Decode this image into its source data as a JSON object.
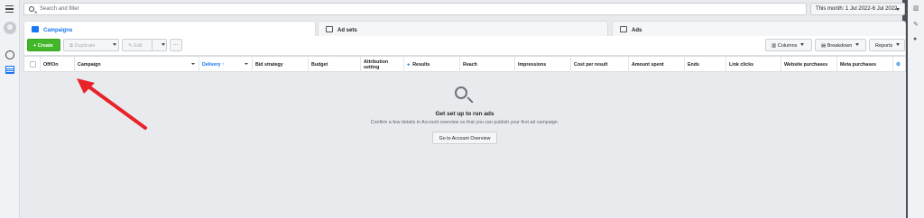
{
  "search": {
    "placeholder": "Search and filter"
  },
  "date_range": "This month: 1 Jul 2022-6 Jul 2022",
  "tabs": [
    {
      "label": "Campaigns"
    },
    {
      "label": "Ad sets"
    },
    {
      "label": "Ads"
    }
  ],
  "toolbar": {
    "create": "Create",
    "duplicate": "Duplicate",
    "edit": "Edit",
    "more": "···",
    "columns": "Columns",
    "breakdown": "Breakdown",
    "reports": "Reports"
  },
  "columns": [
    "Off/On",
    "Campaign",
    "Delivery ↑",
    "Bid strategy",
    "Budget",
    "Attribution setting",
    "Results",
    "Reach",
    "Impressions",
    "Cost per result",
    "Amount spent",
    "Ends",
    "Link clicks",
    "Website purchases",
    "Meta purchases"
  ],
  "empty_state": {
    "title": "Get set up to run ads",
    "subtitle": "Confirm a few details in Account overview so that you can publish your first ad campaign.",
    "button": "Go to Account Overview"
  },
  "colors": {
    "accent": "#1877f2",
    "create": "#42b72a",
    "annotation_arrow": "#e8232a"
  },
  "icons": [
    "menu-icon",
    "avatar-icon",
    "smiley-icon",
    "table-icon",
    "search-icon",
    "chart-icon",
    "pencil-icon",
    "info-icon"
  ]
}
